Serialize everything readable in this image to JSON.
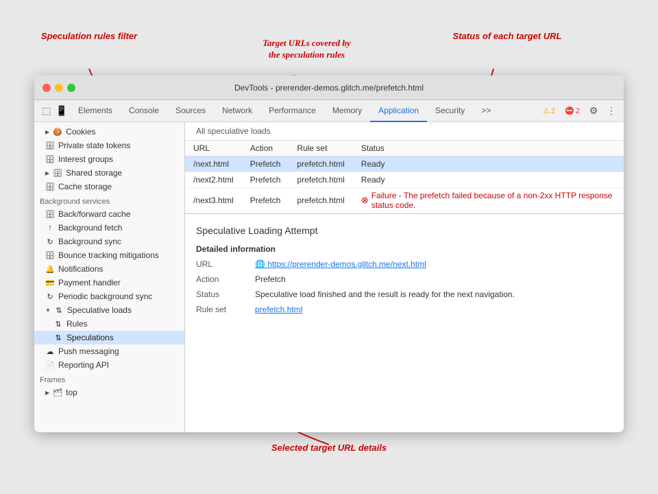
{
  "annotations": {
    "speculation_filter": "Speculation rules filter",
    "target_urls": "Target URLs covered by\nthe speculation rules",
    "status_of_url": "Status of each target URL",
    "selected_details": "Selected target URL details"
  },
  "window": {
    "title": "DevTools - prerender-demos.glitch.me/prefetch.html"
  },
  "toolbar": {
    "tabs": [
      {
        "label": "Elements",
        "active": false
      },
      {
        "label": "Console",
        "active": false
      },
      {
        "label": "Sources",
        "active": false
      },
      {
        "label": "Network",
        "active": false
      },
      {
        "label": "Performance",
        "active": false
      },
      {
        "label": "Memory",
        "active": false
      },
      {
        "label": "Application",
        "active": true
      },
      {
        "label": "Security",
        "active": false
      },
      {
        "label": ">>",
        "active": false
      }
    ],
    "warn_count": "2",
    "err_count": "2"
  },
  "sidebar": {
    "sections": [
      {
        "items": [
          {
            "label": "Cookies",
            "icon": "▶ 🍪",
            "indent": 0
          },
          {
            "label": "Private state tokens",
            "icon": "🗄",
            "indent": 0
          },
          {
            "label": "Interest groups",
            "icon": "🗄",
            "indent": 0
          },
          {
            "label": "Shared storage",
            "icon": "▶ 🗄",
            "indent": 0
          },
          {
            "label": "Cache storage",
            "icon": "🗄",
            "indent": 0
          }
        ]
      },
      {
        "title": "Background services",
        "items": [
          {
            "label": "Back/forward cache",
            "icon": "🗄",
            "indent": 0
          },
          {
            "label": "Background fetch",
            "icon": "↑",
            "indent": 0
          },
          {
            "label": "Background sync",
            "icon": "↻",
            "indent": 0
          },
          {
            "label": "Bounce tracking mitigations",
            "icon": "🗄",
            "indent": 0
          },
          {
            "label": "Notifications",
            "icon": "🔔",
            "indent": 0
          },
          {
            "label": "Payment handler",
            "icon": "💳",
            "indent": 0
          },
          {
            "label": "Periodic background sync",
            "icon": "↻",
            "indent": 0
          },
          {
            "label": "Speculative loads",
            "icon": "▼ ↑↓",
            "indent": 0
          },
          {
            "label": "Rules",
            "icon": "↑↓",
            "indent": 1
          },
          {
            "label": "Speculations",
            "icon": "↑↓",
            "indent": 1,
            "selected": true
          },
          {
            "label": "Push messaging",
            "icon": "☁",
            "indent": 0
          },
          {
            "label": "Reporting API",
            "icon": "📄",
            "indent": 0
          }
        ]
      },
      {
        "title": "Frames",
        "items": [
          {
            "label": "top",
            "icon": "▶ 🗂",
            "indent": 0
          }
        ]
      }
    ]
  },
  "main": {
    "all_speculative_loads_label": "All speculative loads",
    "table": {
      "headers": [
        "URL",
        "Action",
        "Rule set",
        "Status"
      ],
      "rows": [
        {
          "url": "/next.html",
          "action": "Prefetch",
          "rule_set": "prefetch.html",
          "status": "Ready",
          "error": false
        },
        {
          "url": "/next2.html",
          "action": "Prefetch",
          "rule_set": "prefetch.html",
          "status": "Ready",
          "error": false
        },
        {
          "url": "/next3.html",
          "action": "Prefetch",
          "rule_set": "prefetch.html",
          "status": "Failure - The prefetch failed because of a non-2xx HTTP response status code.",
          "error": true
        }
      ]
    },
    "detail": {
      "title": "Speculative Loading Attempt",
      "section_title": "Detailed information",
      "rows": [
        {
          "label": "URL",
          "value": "https://prerender-demos.glitch.me/next.html",
          "is_link": true
        },
        {
          "label": "Action",
          "value": "Prefetch",
          "is_link": false
        },
        {
          "label": "Status",
          "value": "Speculative load finished and the result is ready for the next navigation.",
          "is_link": false
        },
        {
          "label": "Rule set",
          "value": "prefetch.html",
          "is_link": true
        }
      ]
    }
  }
}
